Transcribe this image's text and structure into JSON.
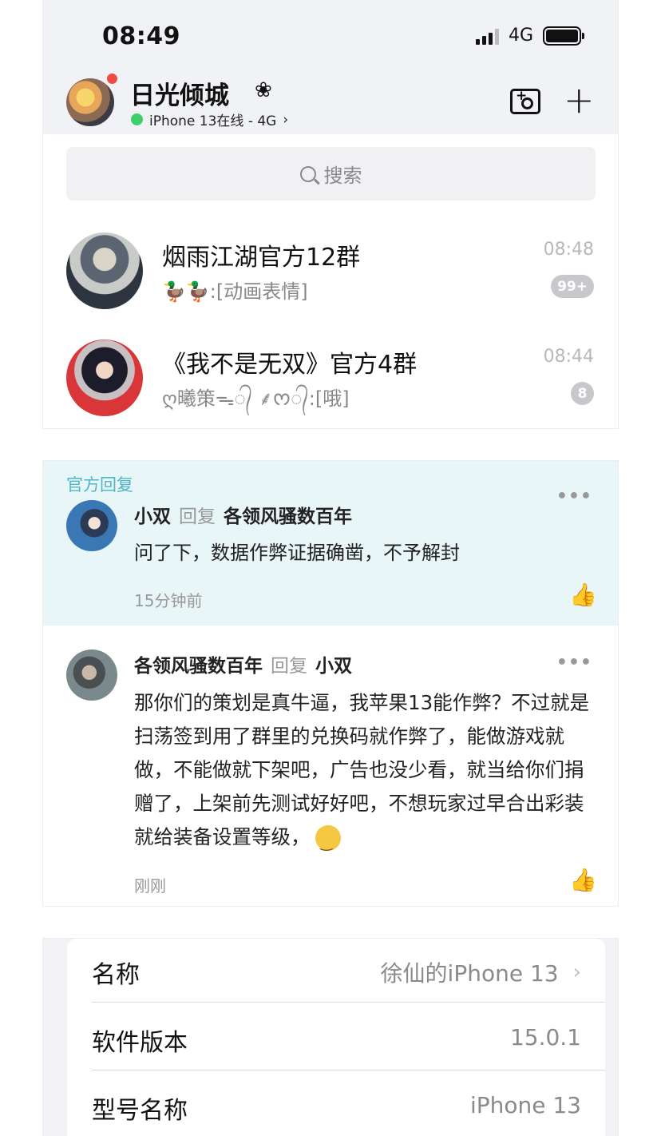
{
  "status_bar": {
    "time": "08:49",
    "network": "4G"
  },
  "header": {
    "name": "日光倾城",
    "flower": "❀",
    "online_status": "iPhone 13在线 - 4G",
    "status_chevron": "›"
  },
  "search": {
    "placeholder": "搜索"
  },
  "chats": [
    {
      "title": "烟雨江湖官方12群",
      "preview": "🦆🦆:[动画表情]",
      "time": "08:48",
      "badge": "99+"
    },
    {
      "title": "《我不是无双》官方4群",
      "preview": "ღ曦策ᯓ᭄ ⸙ᰔ᭄:[哦]",
      "time": "08:44",
      "badge": "8"
    }
  ],
  "comments": {
    "official_label": "官方回复",
    "items": [
      {
        "author": "小双",
        "reply_word": "回复",
        "target": "各领风骚数百年",
        "text": "问了下，数据作弊证据确凿，不予解封",
        "time": "15分钟前"
      },
      {
        "author": "各领风骚数百年",
        "reply_word": "回复",
        "target": "小双",
        "text": "那你们的策划是真牛逼，我苹果13能作弊？不过就是扫荡签到用了群里的兑换码就作弊了，能做游戏就做，不能做就下架吧，广告也没少看，就当给你们捐赠了，上架前先测试好好吧，不想玩家过早合出彩装就给装备设置等级，",
        "time": "刚刚"
      }
    ],
    "more_glyph": "•••",
    "like_glyph": "👍"
  },
  "settings": {
    "rows": [
      {
        "label": "名称",
        "value": "徐仙的iPhone 13",
        "chevron": "›"
      },
      {
        "label": "软件版本",
        "value": "15.0.1"
      },
      {
        "label": "型号名称",
        "value": "iPhone 13"
      }
    ]
  },
  "colors": {
    "accent_teal": "#4fb6c8",
    "highlight_bg": "#e8f6f8",
    "online_green": "#3ecf6a",
    "badge_red": "#f04c3f"
  }
}
